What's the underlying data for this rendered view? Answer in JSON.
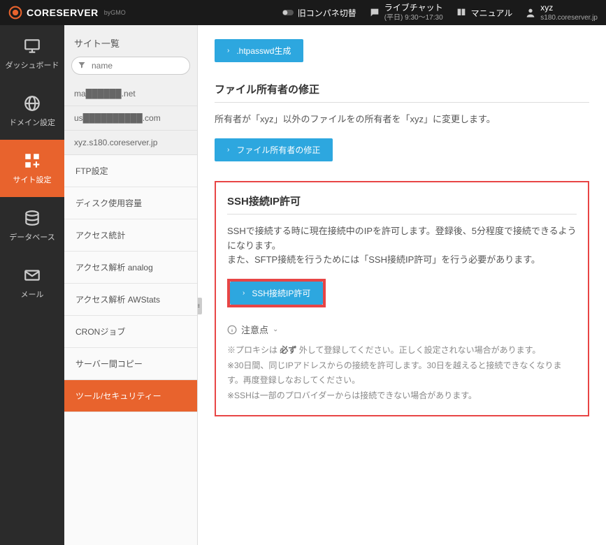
{
  "header": {
    "logo_main": "CORESERVER",
    "logo_sub": "byGMO",
    "old_panel": "旧コンパネ切替",
    "live_chat": "ライブチャット",
    "live_chat_hours": "(平日) 9:30～17:30",
    "manual": "マニュアル",
    "user_name": "xyz",
    "user_server": "s180.coreserver.jp"
  },
  "main_nav": [
    {
      "label": "ダッシュボード",
      "icon": "monitor"
    },
    {
      "label": "ドメイン設定",
      "icon": "globe"
    },
    {
      "label": "サイト設定",
      "icon": "grid-plus",
      "active": true
    },
    {
      "label": "データベース",
      "icon": "database"
    },
    {
      "label": "メール",
      "icon": "mail"
    }
  ],
  "site_list": {
    "title": "サイト一覧",
    "search_placeholder": "name",
    "items": [
      "ma██████.net",
      "us██████████.com",
      "xyz.s180.coreserver.jp"
    ]
  },
  "tool_nav": [
    {
      "label": "FTP設定"
    },
    {
      "label": "ディスク使用容量"
    },
    {
      "label": "アクセス統計"
    },
    {
      "label": "アクセス解析 analog"
    },
    {
      "label": "アクセス解析 AWStats"
    },
    {
      "label": "CRONジョブ"
    },
    {
      "label": "サーバー間コピー"
    },
    {
      "label": "ツール/セキュリティー",
      "active": true
    }
  ],
  "content": {
    "htpasswd_btn": ".htpasswd生成",
    "owner_fix_title": "ファイル所有者の修正",
    "owner_fix_text": "所有者が「xyz」以外のファイルをの所有者を「xyz」に変更します。",
    "owner_fix_btn": "ファイル所有者の修正",
    "ssh_title": "SSH接続IP許可",
    "ssh_text1": "SSHで接続する時に現在接続中のIPを許可します。登録後、5分程度で接続できるようになります。",
    "ssh_text2": "また、SFTP接続を行うためには「SSH接続IP許可」を行う必要があります。",
    "ssh_btn": "SSH接続IP許可",
    "notice_title": "注意点",
    "notice_line1a": "※プロキシは ",
    "notice_line1b": "必ず",
    "notice_line1c": " 外して登録してください。正しく設定されない場合があります。",
    "notice_line2": "※30日間、同じIPアドレスからの接続を許可します。30日を越えると接続できなくなります。再度登録しなおしてください。",
    "notice_line3": "※SSHは一部のプロバイダーからは接続できない場合があります。"
  }
}
